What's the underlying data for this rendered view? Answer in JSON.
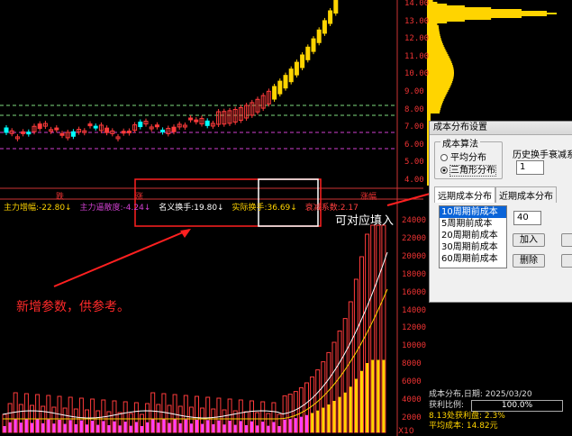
{
  "price_axis": [
    "14.00",
    "13.00",
    "12.00",
    "11.00",
    "10.00",
    "9.00",
    "8.00",
    "7.00",
    "6.00",
    "5.00",
    "4.00"
  ],
  "volume_axis": [
    "24000",
    "22000",
    "20000",
    "18000",
    "16000",
    "14000",
    "12000",
    "10000",
    "8000",
    "6000",
    "4000",
    "2000"
  ],
  "volume_unit": "X10",
  "markers": {
    "left": "跌",
    "mid": "涨",
    "right": "涨幅"
  },
  "indicators": {
    "a_label": "主力增幅:",
    "a_value": "-22.80↓",
    "b_label": "主力逼散度:",
    "b_value": "-4.24↓",
    "c_label": "名义换手:",
    "c_value": "19.80↓",
    "d_label": "实际换手:",
    "d_value": "36.69↓",
    "e_label": "衰减系数:",
    "e_value": "2.17"
  },
  "annotations": {
    "note1": "新增参数，供参考。",
    "note2": "可对应填入"
  },
  "dialog": {
    "title": "成本分布设置",
    "algo_group": "成本算法",
    "radio_avg": "平均分布",
    "radio_tri": "三角形分布",
    "decay_label": "历史换手衰减系数",
    "decay_value": "1",
    "tab_far": "远期成本分布",
    "tab_near": "近期成本分布",
    "list": [
      "10周期前成本",
      "5周期前成本",
      "20周期前成本",
      "30周期前成本",
      "60周期前成本"
    ],
    "period_value": "40",
    "add_button": "加入",
    "delete_button": "删除"
  },
  "info_panel": {
    "line1": "成本分布,日期: 2025/03/20",
    "profit_label": "获利比例:",
    "profit_value": "100.0%",
    "line3": "8.13处获利盘: 2.3%",
    "line4": "平均成本: 14.82元"
  },
  "colors": {
    "up": "#ff3b3b",
    "down": "#00ffff",
    "yellow": "#ffd400",
    "magenta": "#ff40ff",
    "grid": "#7fdc7f"
  }
}
